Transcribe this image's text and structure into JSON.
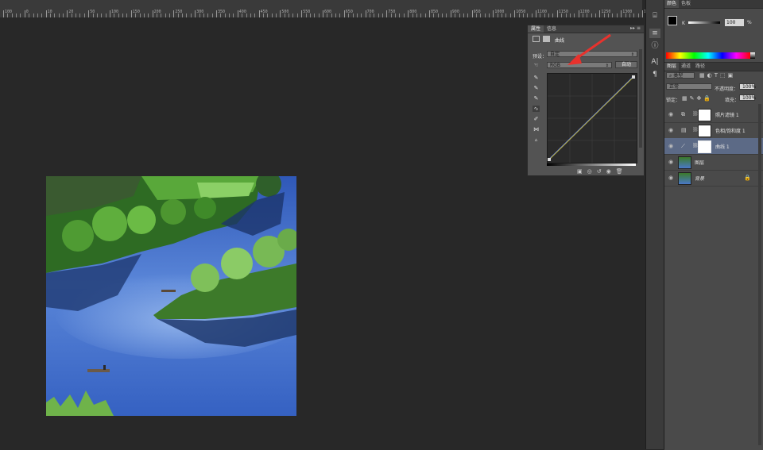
{
  "ruler": {
    "labels": [
      "100",
      "0",
      "10",
      "20",
      "50",
      "100",
      "150",
      "200",
      "250",
      "300",
      "350",
      "400",
      "450",
      "500",
      "550",
      "600",
      "650",
      "700",
      "750",
      "800",
      "850",
      "900",
      "950",
      "1000",
      "1050",
      "1100",
      "1150",
      "1200",
      "1250",
      "1300",
      "1350",
      "1400"
    ]
  },
  "properties_panel": {
    "tabs": [
      "属性",
      "信息"
    ],
    "title": "曲线",
    "preset_label": "预设：",
    "preset_value": "自定",
    "channel_value": "RGB",
    "auto_button": "自动"
  },
  "color_panel": {
    "tabs": [
      "颜色",
      "色板"
    ],
    "channel_label": "K",
    "channel_value": "100",
    "unit": "%"
  },
  "layers_panel": {
    "tabs": [
      "图层",
      "通道",
      "路径"
    ],
    "filter_kind": "类型",
    "blend_mode": "正常",
    "opacity_label": "不透明度：",
    "opacity_value": "100%",
    "lock_label": "锁定：",
    "fill_label": "填充：",
    "fill_value": "100%",
    "layers": [
      {
        "name": "照片滤镜 1",
        "type": "adjustment"
      },
      {
        "name": "色相/饱和度 1",
        "type": "adjustment"
      },
      {
        "name": "曲线 1",
        "type": "adjustment",
        "selected": true
      },
      {
        "name": "图层",
        "type": "pixel"
      },
      {
        "name": "背景",
        "type": "background"
      }
    ]
  },
  "colors": {
    "workspace": "#282828",
    "panel": "#535353",
    "selection": "#5c6a86",
    "annotation_arrow": "#e8322d"
  }
}
